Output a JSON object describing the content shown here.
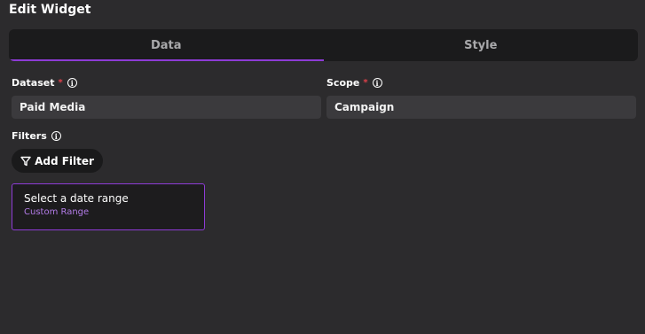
{
  "header": {
    "title": "Edit Widget"
  },
  "tabs": [
    {
      "label": "Data",
      "active": true
    },
    {
      "label": "Style",
      "active": false
    }
  ],
  "fields": {
    "dataset": {
      "label": "Dataset",
      "required_mark": "*",
      "value": "Paid Media"
    },
    "scope": {
      "label": "Scope",
      "required_mark": "*",
      "value": "Campaign"
    }
  },
  "filters": {
    "label": "Filters",
    "add_button_label": "Add Filter"
  },
  "date_range": {
    "title": "Select a date range",
    "subtitle": "Custom Range"
  },
  "colors": {
    "accent": "#8e3bd6",
    "background": "#2c2b2d",
    "required": "#e0414b"
  },
  "icons": {
    "info": "info-circle-icon",
    "filter": "funnel-icon"
  }
}
